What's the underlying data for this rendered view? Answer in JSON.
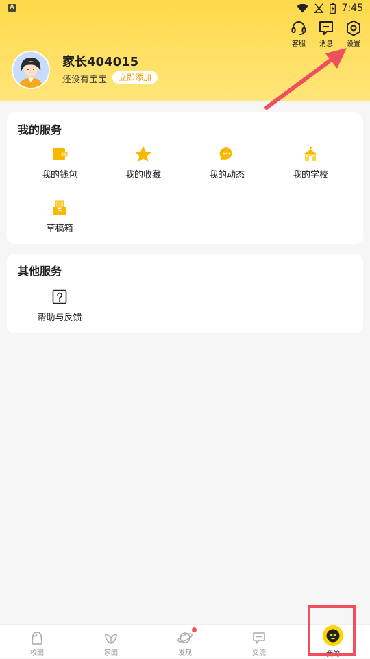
{
  "status_bar": {
    "time": "7:45",
    "app_icon_letter": "A"
  },
  "header": {
    "actions": [
      {
        "label": "客服",
        "icon": "headset-icon"
      },
      {
        "label": "消息",
        "icon": "message-icon"
      },
      {
        "label": "设置",
        "icon": "settings-icon"
      }
    ],
    "username": "家长404015",
    "no_baby_text": "还没有宝宝",
    "add_button": "立即添加"
  },
  "my_services": {
    "title": "我的服务",
    "items": [
      {
        "label": "我的钱包",
        "icon": "wallet-icon"
      },
      {
        "label": "我的收藏",
        "icon": "star-icon"
      },
      {
        "label": "我的动态",
        "icon": "chat-bubble-icon"
      },
      {
        "label": "我的学校",
        "icon": "school-icon"
      },
      {
        "label": "草稿箱",
        "icon": "drafts-tray-icon"
      }
    ]
  },
  "other_services": {
    "title": "其他服务",
    "items": [
      {
        "label": "帮助与反馈",
        "icon": "help-icon"
      }
    ]
  },
  "tab_bar": {
    "tabs": [
      {
        "label": "校园",
        "icon": "campus-icon"
      },
      {
        "label": "家园",
        "icon": "home-leaf-icon"
      },
      {
        "label": "发现",
        "icon": "discover-planet-icon",
        "badge_dot": true
      },
      {
        "label": "交流",
        "icon": "chat-icon"
      },
      {
        "label": "我的",
        "icon": "mine-face-icon",
        "active": true
      }
    ]
  },
  "colors": {
    "accent": "#ffd94a",
    "highlight": "#f0505e",
    "link": "#f5a000"
  }
}
